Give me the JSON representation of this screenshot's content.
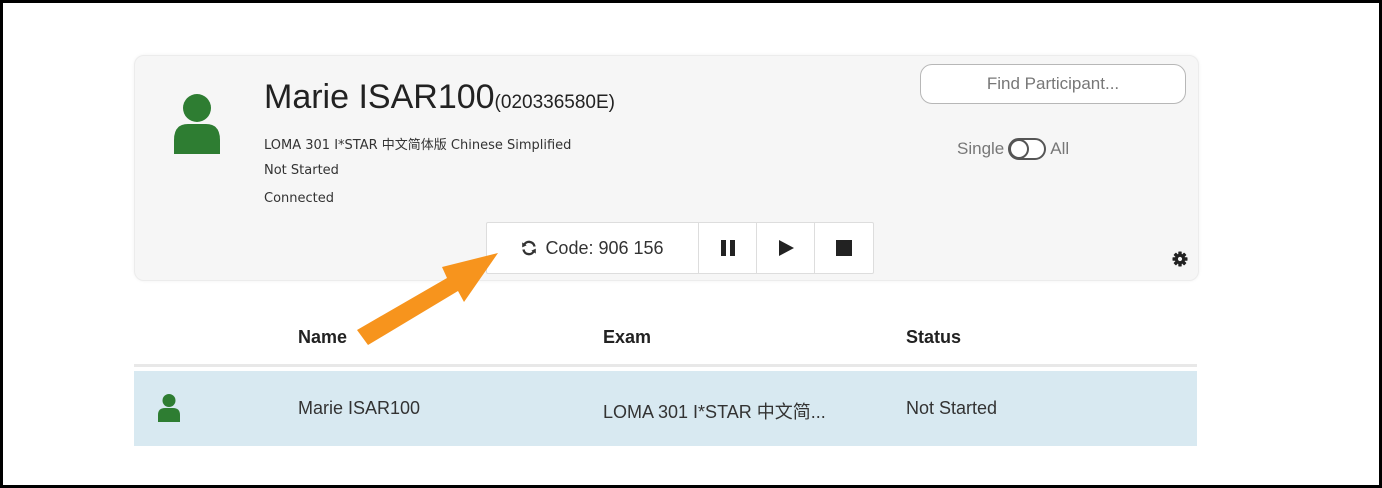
{
  "participant": {
    "name": "Marie ISAR100",
    "id": "(020336580E)",
    "exam": "LOMA 301 I*STAR 中文简体版 Chinese Simplified",
    "status": "Not Started",
    "connection": "Connected",
    "avatar_icon": "person-icon",
    "avatar_color": "#2e7d32"
  },
  "find_button_label": "Find Participant...",
  "toggle": {
    "left_label": "Single",
    "right_label": "All"
  },
  "controls": {
    "code_label": "Code: 906 156",
    "refresh_icon": "refresh-icon",
    "pause_icon": "pause-icon",
    "play_icon": "play-icon",
    "stop_icon": "stop-icon"
  },
  "settings_icon": "gear-icon",
  "annotation": {
    "arrow_color": "#f7941d"
  },
  "table": {
    "headers": {
      "name": "Name",
      "exam": "Exam",
      "status": "Status"
    },
    "rows": [
      {
        "name": "Marie ISAR100",
        "exam": "LOMA 301 I*STAR 中文简...",
        "status": "Not Started"
      }
    ],
    "selected_row_color": "#d8e9f1"
  }
}
